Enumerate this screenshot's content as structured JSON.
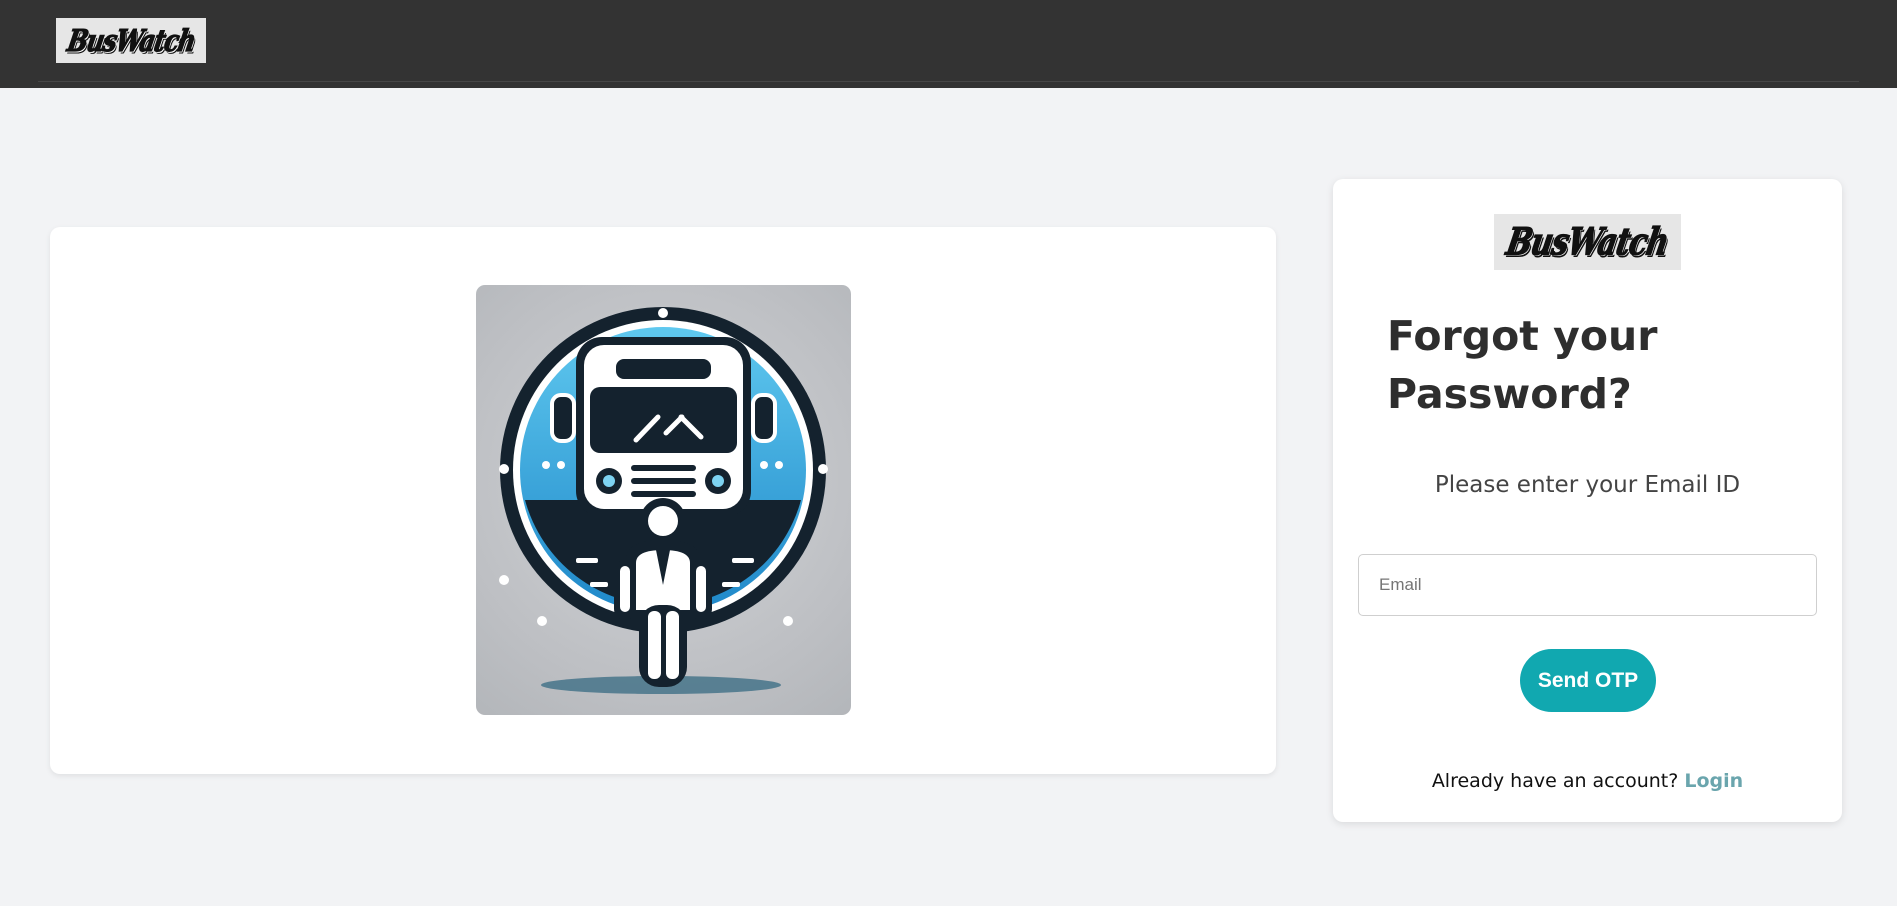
{
  "navbar": {
    "logo_text": "BusWatch"
  },
  "hero": {
    "image_name": "bus-and-driver-illustration"
  },
  "form": {
    "logo_text": "BusWatch",
    "title": "Forgot your Password?",
    "subtitle": "Please enter your Email ID",
    "email": {
      "value": "",
      "placeholder": "Email"
    },
    "send_button_label": "Send OTP",
    "account_prompt": "Already have an account?",
    "login_link_label": "Login"
  },
  "colors": {
    "navbar_bg": "#333333",
    "page_bg": "#f2f3f5",
    "accent": "#11a8b0",
    "link": "#6aa5ad"
  }
}
